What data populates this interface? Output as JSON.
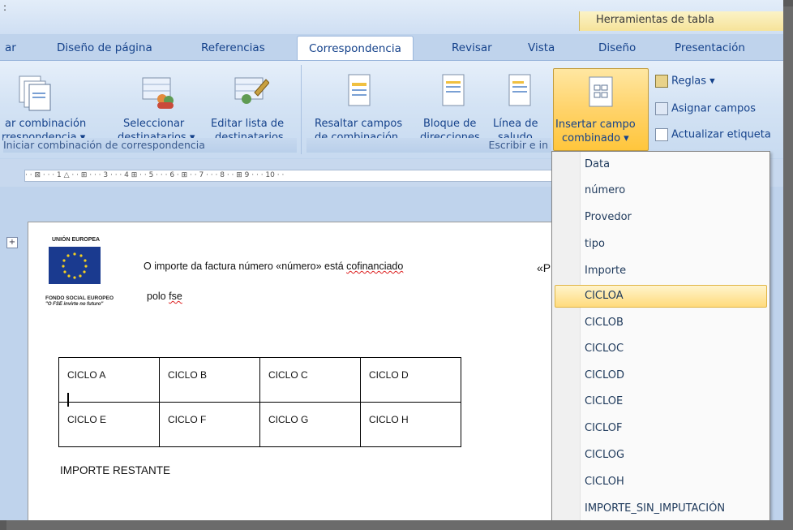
{
  "title_strip": {
    "context_group": "Herramientas de tabla",
    "lone_char": ":"
  },
  "tabs": [
    {
      "label": "ar",
      "active": false
    },
    {
      "label": "Diseño de página",
      "active": false
    },
    {
      "label": "Referencias",
      "active": false
    },
    {
      "label": "Correspondencia",
      "active": true
    },
    {
      "label": "Revisar",
      "active": false
    },
    {
      "label": "Vista",
      "active": false
    },
    {
      "label": "Diseño",
      "active": false
    },
    {
      "label": "Presentación",
      "active": false
    }
  ],
  "ribbon": {
    "start_group": {
      "btn1_line1": "ar combinación",
      "btn1_line2": "rrespondencia ▾",
      "btn2_line1": "Seleccionar",
      "btn2_line2": "destinatarios ▾",
      "btn3_line1": "Editar lista de",
      "btn3_line2": "destinatarios",
      "label": "Iniciar combinación de correspondencia"
    },
    "write_group": {
      "btn1_line1": "Resaltar campos",
      "btn1_line2": "de combinación",
      "btn2_line1": "Bloque de",
      "btn2_line2": "direcciones",
      "btn3_line1": "Línea de",
      "btn3_line2": "saludo",
      "btn4_line1": "Insertar campo",
      "btn4_line2": "combinado ▾",
      "label": "Escribir e in"
    },
    "right_buttons": {
      "rules": "Reglas ▾",
      "assign": "Asignar campos",
      "update": "Actualizar etiqueta"
    }
  },
  "ruler": {
    "text": "· · ⊠ · · · 1 △ · · ⊞ · · · 3 · · · 4 ⊞ · · 5 · · · 6 · ⊞ · · 7 · · · 8 · · ⊞ 9 · · · 10 · ·"
  },
  "document": {
    "logo_top": "UNIÓN EUROPEA",
    "logo_bottom1": "FONDO SOCIAL EUROPEO",
    "logo_bottom2": "\"O FSE invirte no futuro\"",
    "line1_pre": "O importe da factura número «número» está ",
    "line1_err": "cofinanciado",
    "line2_pre": "polo ",
    "line2_err": "fse",
    "merge_partial": "«P",
    "table": [
      [
        "CICLO A",
        "CICLO B",
        "CICLO C",
        "CICLO D"
      ],
      [
        "CICLO E",
        "CICLO F",
        "CICLO G",
        "CICLO H"
      ]
    ],
    "after_table": "IMPORTE RESTANTE"
  },
  "menu": {
    "items": [
      "Data",
      "número",
      "Provedor",
      "tipo",
      "Importe",
      "CICLOA",
      "CICLOB",
      "CICLOC",
      "CICLOD",
      "CICLOE",
      "CICLOF",
      "CICLOG",
      "CICLOH",
      "IMPORTE_SIN_IMPUTACIÓN"
    ],
    "highlighted": "CICLOA"
  }
}
